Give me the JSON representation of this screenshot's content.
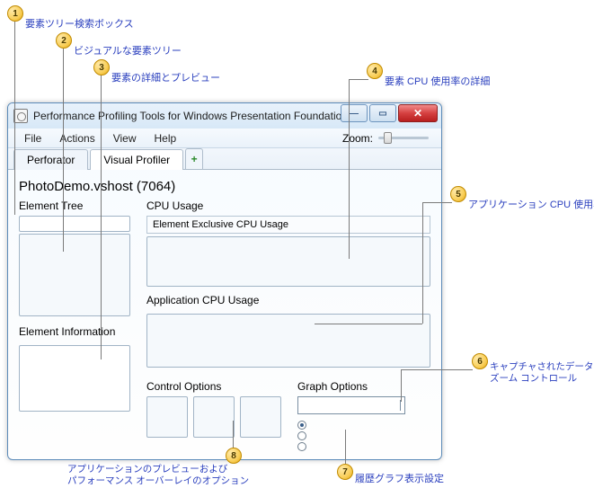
{
  "callouts": {
    "c1": "要素ツリー検索ボックス",
    "c2": "ビジュアルな要素ツリー",
    "c3": "要素の詳細とプレビュー",
    "c4": "要素 CPU 使用率の詳細",
    "c5": "アプリケーション CPU 使用率の詳細",
    "c6": "キャプチャされたデータの\nズーム コントロール",
    "c6a": "キャプチャされたデータの",
    "c6b": "ズーム コントロール",
    "c7": "履歴グラフ表示設定",
    "c8": "アプリケーションのプレビューおよびパフォーマンス オーバーレイのオプション",
    "c8a": "アプリケーションのプレビューおよび",
    "c8b": "パフォーマンス オーバーレイのオプション"
  },
  "window": {
    "title": "Performance Profiling Tools for Windows Presentation Foundation"
  },
  "menu": {
    "file": "File",
    "actions": "Actions",
    "view": "View",
    "help": "Help",
    "zoom": "Zoom:"
  },
  "tabs": {
    "perforator": "Perforator",
    "visual_profiler": "Visual Profiler",
    "add": "+"
  },
  "process": "PhotoDemo.vshost (7064)",
  "left": {
    "element_tree": "Element Tree",
    "element_info": "Element Information"
  },
  "right": {
    "cpu_usage": "CPU Usage",
    "element_exclusive": "Element Exclusive CPU Usage",
    "app_cpu": "Application CPU Usage",
    "control_options": "Control Options",
    "graph_options": "Graph Options"
  }
}
